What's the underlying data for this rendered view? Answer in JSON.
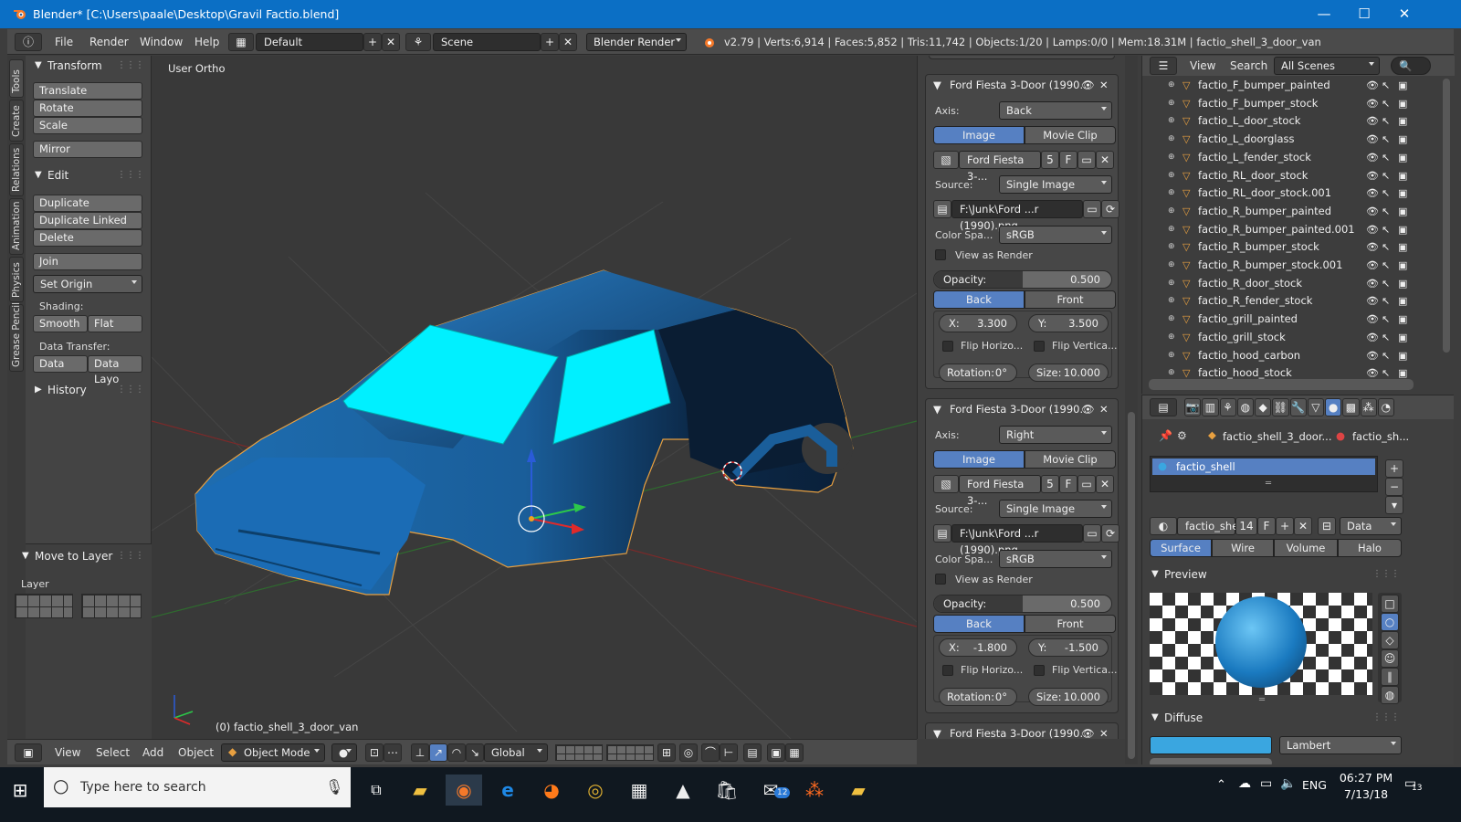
{
  "window": {
    "title": "Blender* [C:\\Users\\paale\\Desktop\\Gravil Factio.blend]",
    "minimize": "—",
    "maximize": "☐",
    "close": "✕"
  },
  "menubar": {
    "items": [
      "File",
      "Render",
      "Window",
      "Help"
    ],
    "layout": "Default",
    "scene": "Scene",
    "engine": "Blender Render",
    "stats": "v2.79 | Verts:6,914 | Faces:5,852 | Tris:11,742 | Objects:1/20 | Lamps:0/0 | Mem:18.31M | factio_shell_3_door_van"
  },
  "lefttabs": [
    "Tools",
    "Create",
    "Relations",
    "Animation",
    "Physics",
    "Grease Pencil"
  ],
  "toolshelf": {
    "transform": {
      "title": "Transform",
      "buttons": [
        "Translate",
        "Rotate",
        "Scale",
        "Mirror"
      ]
    },
    "edit": {
      "title": "Edit",
      "buttons": [
        "Duplicate",
        "Duplicate Linked",
        "Delete",
        "Join",
        "Set Origin"
      ]
    },
    "shading": {
      "label": "Shading:",
      "smooth": "Smooth",
      "flat": "Flat"
    },
    "datatransfer": {
      "label": "Data Transfer:",
      "data": "Data",
      "datalayo": "Data Layo"
    },
    "history": "History",
    "movetolayer": {
      "title": "Move to Layer",
      "layer": "Layer"
    }
  },
  "viewport": {
    "view_label": "User Ortho",
    "object_label": "(0) factio_shell_3_door_van"
  },
  "vpheader": {
    "items": [
      "View",
      "Select",
      "Add",
      "Object"
    ],
    "mode": "Object Mode",
    "orientation": "Global"
  },
  "bgimages": [
    {
      "title": "Ford Fiesta 3-Door (1990...",
      "axis_label": "Axis:",
      "axis": "Back",
      "tab_image": "Image",
      "tab_movieclip": "Movie Clip",
      "image_name": "Ford Fiesta 3-...",
      "users": "5",
      "fake": "F",
      "source_label": "Source:",
      "source": "Single Image",
      "path": "F:\\Junk\\Ford ...r (1990).png",
      "colorspace_label": "Color Spa...",
      "colorspace": "sRGB",
      "view_as_render": "View as Render",
      "opacity_label": "Opacity:",
      "opacity": "0.500",
      "opacity_fraction": 0.5,
      "back": "Back",
      "front": "Front",
      "x_label": "X:",
      "x": "3.300",
      "y_label": "Y:",
      "y": "3.500",
      "flip_h": "Flip Horizo...",
      "flip_v": "Flip Vertica...",
      "rotation_label": "Rotation:",
      "rotation": "0°",
      "size_label": "Size:",
      "size": "10.000"
    },
    {
      "title": "Ford Fiesta 3-Door (1990...",
      "axis_label": "Axis:",
      "axis": "Right",
      "tab_image": "Image",
      "tab_movieclip": "Movie Clip",
      "image_name": "Ford Fiesta 3-...",
      "users": "5",
      "fake": "F",
      "source_label": "Source:",
      "source": "Single Image",
      "path": "F:\\Junk\\Ford ...r (1990).png",
      "colorspace_label": "Color Spa...",
      "colorspace": "sRGB",
      "view_as_render": "View as Render",
      "opacity_label": "Opacity:",
      "opacity": "0.500",
      "opacity_fraction": 0.5,
      "back": "Back",
      "front": "Front",
      "x_label": "X:",
      "x": "-1.800",
      "y_label": "Y:",
      "y": "-1.500",
      "flip_h": "Flip Horizo...",
      "flip_v": "Flip Vertica...",
      "rotation_label": "Rotation:",
      "rotation": "0°",
      "size_label": "Size:",
      "size": "10.000"
    },
    {
      "title": "Ford Fiesta 3-Door (1990..."
    }
  ],
  "outliner": {
    "view": "View",
    "search": "Search",
    "filter": "All Scenes",
    "items": [
      "factio_F_bumper_painted",
      "factio_F_bumper_stock",
      "factio_L_door_stock",
      "factio_L_doorglass",
      "factio_L_fender_stock",
      "factio_RL_door_stock",
      "factio_RL_door_stock.001",
      "factio_R_bumper_painted",
      "factio_R_bumper_painted.001",
      "factio_R_bumper_stock",
      "factio_R_bumper_stock.001",
      "factio_R_door_stock",
      "factio_R_fender_stock",
      "factio_grill_painted",
      "factio_grill_stock",
      "factio_hood_carbon",
      "factio_hood_stock"
    ]
  },
  "material": {
    "breadcrumb1": "factio_shell_3_door...",
    "breadcrumb2": "factio_sh...",
    "slot": "factio_shell",
    "matname": "factio_she",
    "users": "14",
    "fake": "F",
    "link": "Data",
    "tabs": [
      "Surface",
      "Wire",
      "Volume",
      "Halo"
    ],
    "preview": "Preview",
    "diffuse": "Diffuse",
    "shader": "Lambert",
    "diffuse_color": "#3aa6e0"
  },
  "taskbar": {
    "search_placeholder": "Type here to search",
    "lang": "ENG",
    "time": "06:27 PM",
    "date": "7/13/18",
    "mail_badge": "12",
    "notif": "13"
  }
}
